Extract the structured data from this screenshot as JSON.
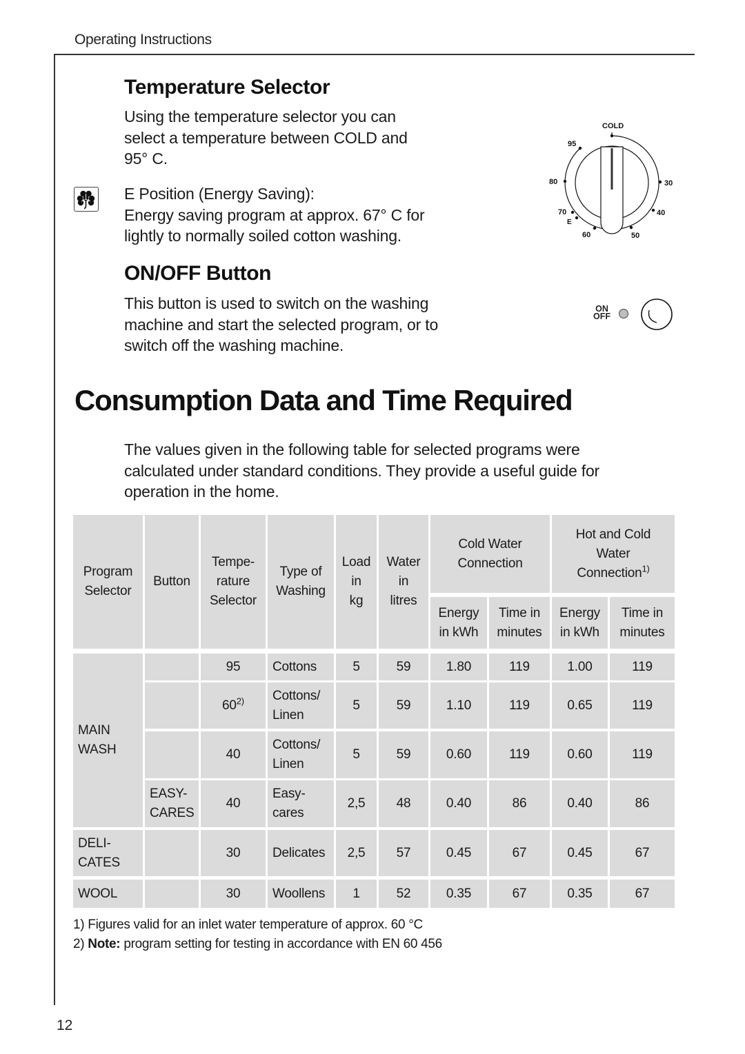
{
  "header": {
    "running_title": "Operating Instructions"
  },
  "temperature_selector": {
    "heading": "Temperature Selector",
    "paragraph_lines": [
      "Using the temperature selector you can",
      "select a temperature between COLD and",
      "95° C."
    ],
    "e_position_heading": "E Position (Energy Saving):",
    "e_position_lines": [
      "Energy saving program at approx. 67° C for",
      "lightly to normally soiled cotton washing."
    ],
    "energy_icon": "shamrock-icon",
    "dial": {
      "icon": "temperature-dial-icon",
      "labels": {
        "cold": "COLD",
        "t95": "95",
        "t80": "80",
        "t70": "70",
        "e": "E",
        "t60": "60",
        "t50": "50",
        "t40": "40",
        "t30": "30"
      }
    }
  },
  "on_off": {
    "heading": "ON/OFF Button",
    "paragraph_lines": [
      "This button is used to switch on the washing",
      "machine and start the selected program, or to",
      "switch off the washing machine."
    ],
    "label_on": "ON",
    "label_off": "OFF",
    "indicator_icon": "indicator-light-icon",
    "button_icon": "power-button-icon"
  },
  "consumption": {
    "heading": "Consumption Data and Time Required",
    "intro_lines": [
      "The values given in the following table for selected programs were",
      "calculated under standard conditions. They provide a useful guide for",
      "operation in the home."
    ]
  },
  "table": {
    "headers": {
      "program_selector": [
        "Program",
        "Selector"
      ],
      "button": "Button",
      "temperature_selector": [
        "Tempe-",
        "rature",
        "Selector"
      ],
      "type_of_washing": [
        "Type of",
        "Washing"
      ],
      "load": [
        "Load",
        "in",
        "kg"
      ],
      "water": [
        "Water",
        "in",
        "litres"
      ],
      "cold_water_connection": [
        "Cold Water",
        "Connection"
      ],
      "hot_cold_connection": [
        "Hot and Cold",
        "Water",
        "Connection"
      ],
      "hot_cold_footnote": "1)",
      "energy": [
        "Energy",
        "in kWh"
      ],
      "time": [
        "Time in",
        "minutes"
      ]
    },
    "program_groups": [
      {
        "label": [
          "MAIN",
          "WASH"
        ]
      },
      {
        "label": [
          "DELI-",
          "CATES"
        ]
      },
      {
        "label": [
          "WOOL"
        ]
      }
    ],
    "rows": [
      {
        "button": "",
        "temp": "95",
        "temp_note": "",
        "type": [
          "Cottons"
        ],
        "load": "5",
        "water": "59",
        "cold_energy": "1.80",
        "cold_time": "119",
        "hot_energy": "1.00",
        "hot_time": "119"
      },
      {
        "button": "",
        "temp": "60",
        "temp_note": "2)",
        "type": [
          "Cottons/",
          "Linen"
        ],
        "load": "5",
        "water": "59",
        "cold_energy": "1.10",
        "cold_time": "119",
        "hot_energy": "0.65",
        "hot_time": "119"
      },
      {
        "button": "",
        "temp": "40",
        "temp_note": "",
        "type": [
          "Cottons/",
          "Linen"
        ],
        "load": "5",
        "water": "59",
        "cold_energy": "0.60",
        "cold_time": "119",
        "hot_energy": "0.60",
        "hot_time": "119"
      },
      {
        "button": [
          "EASY-",
          "CARES"
        ],
        "temp": "40",
        "temp_note": "",
        "type": [
          "Easy-",
          "cares"
        ],
        "load": "2,5",
        "water": "48",
        "cold_energy": "0.40",
        "cold_time": "86",
        "hot_energy": "0.40",
        "hot_time": "86"
      },
      {
        "button": "",
        "temp": "30",
        "temp_note": "",
        "type": [
          "Delicates"
        ],
        "load": "2,5",
        "water": "57",
        "cold_energy": "0.45",
        "cold_time": "67",
        "hot_energy": "0.45",
        "hot_time": "67"
      },
      {
        "button": "",
        "temp": "30",
        "temp_note": "",
        "type": [
          "Woollens"
        ],
        "load": "1",
        "water": "52",
        "cold_energy": "0.35",
        "cold_time": "67",
        "hot_energy": "0.35",
        "hot_time": "67"
      }
    ]
  },
  "footnotes": [
    {
      "marker": "1)",
      "bold": "",
      "text": "Figures valid for an inlet water temperature of approx. 60 °C"
    },
    {
      "marker": "2)",
      "bold": "Note:",
      "text": " program setting for testing in accordance with EN 60 456"
    }
  ],
  "page_number": "12",
  "colors": {
    "table_cell_bg": "#dbdbdb",
    "text": "#1a1a1a",
    "rule": "#333333"
  }
}
